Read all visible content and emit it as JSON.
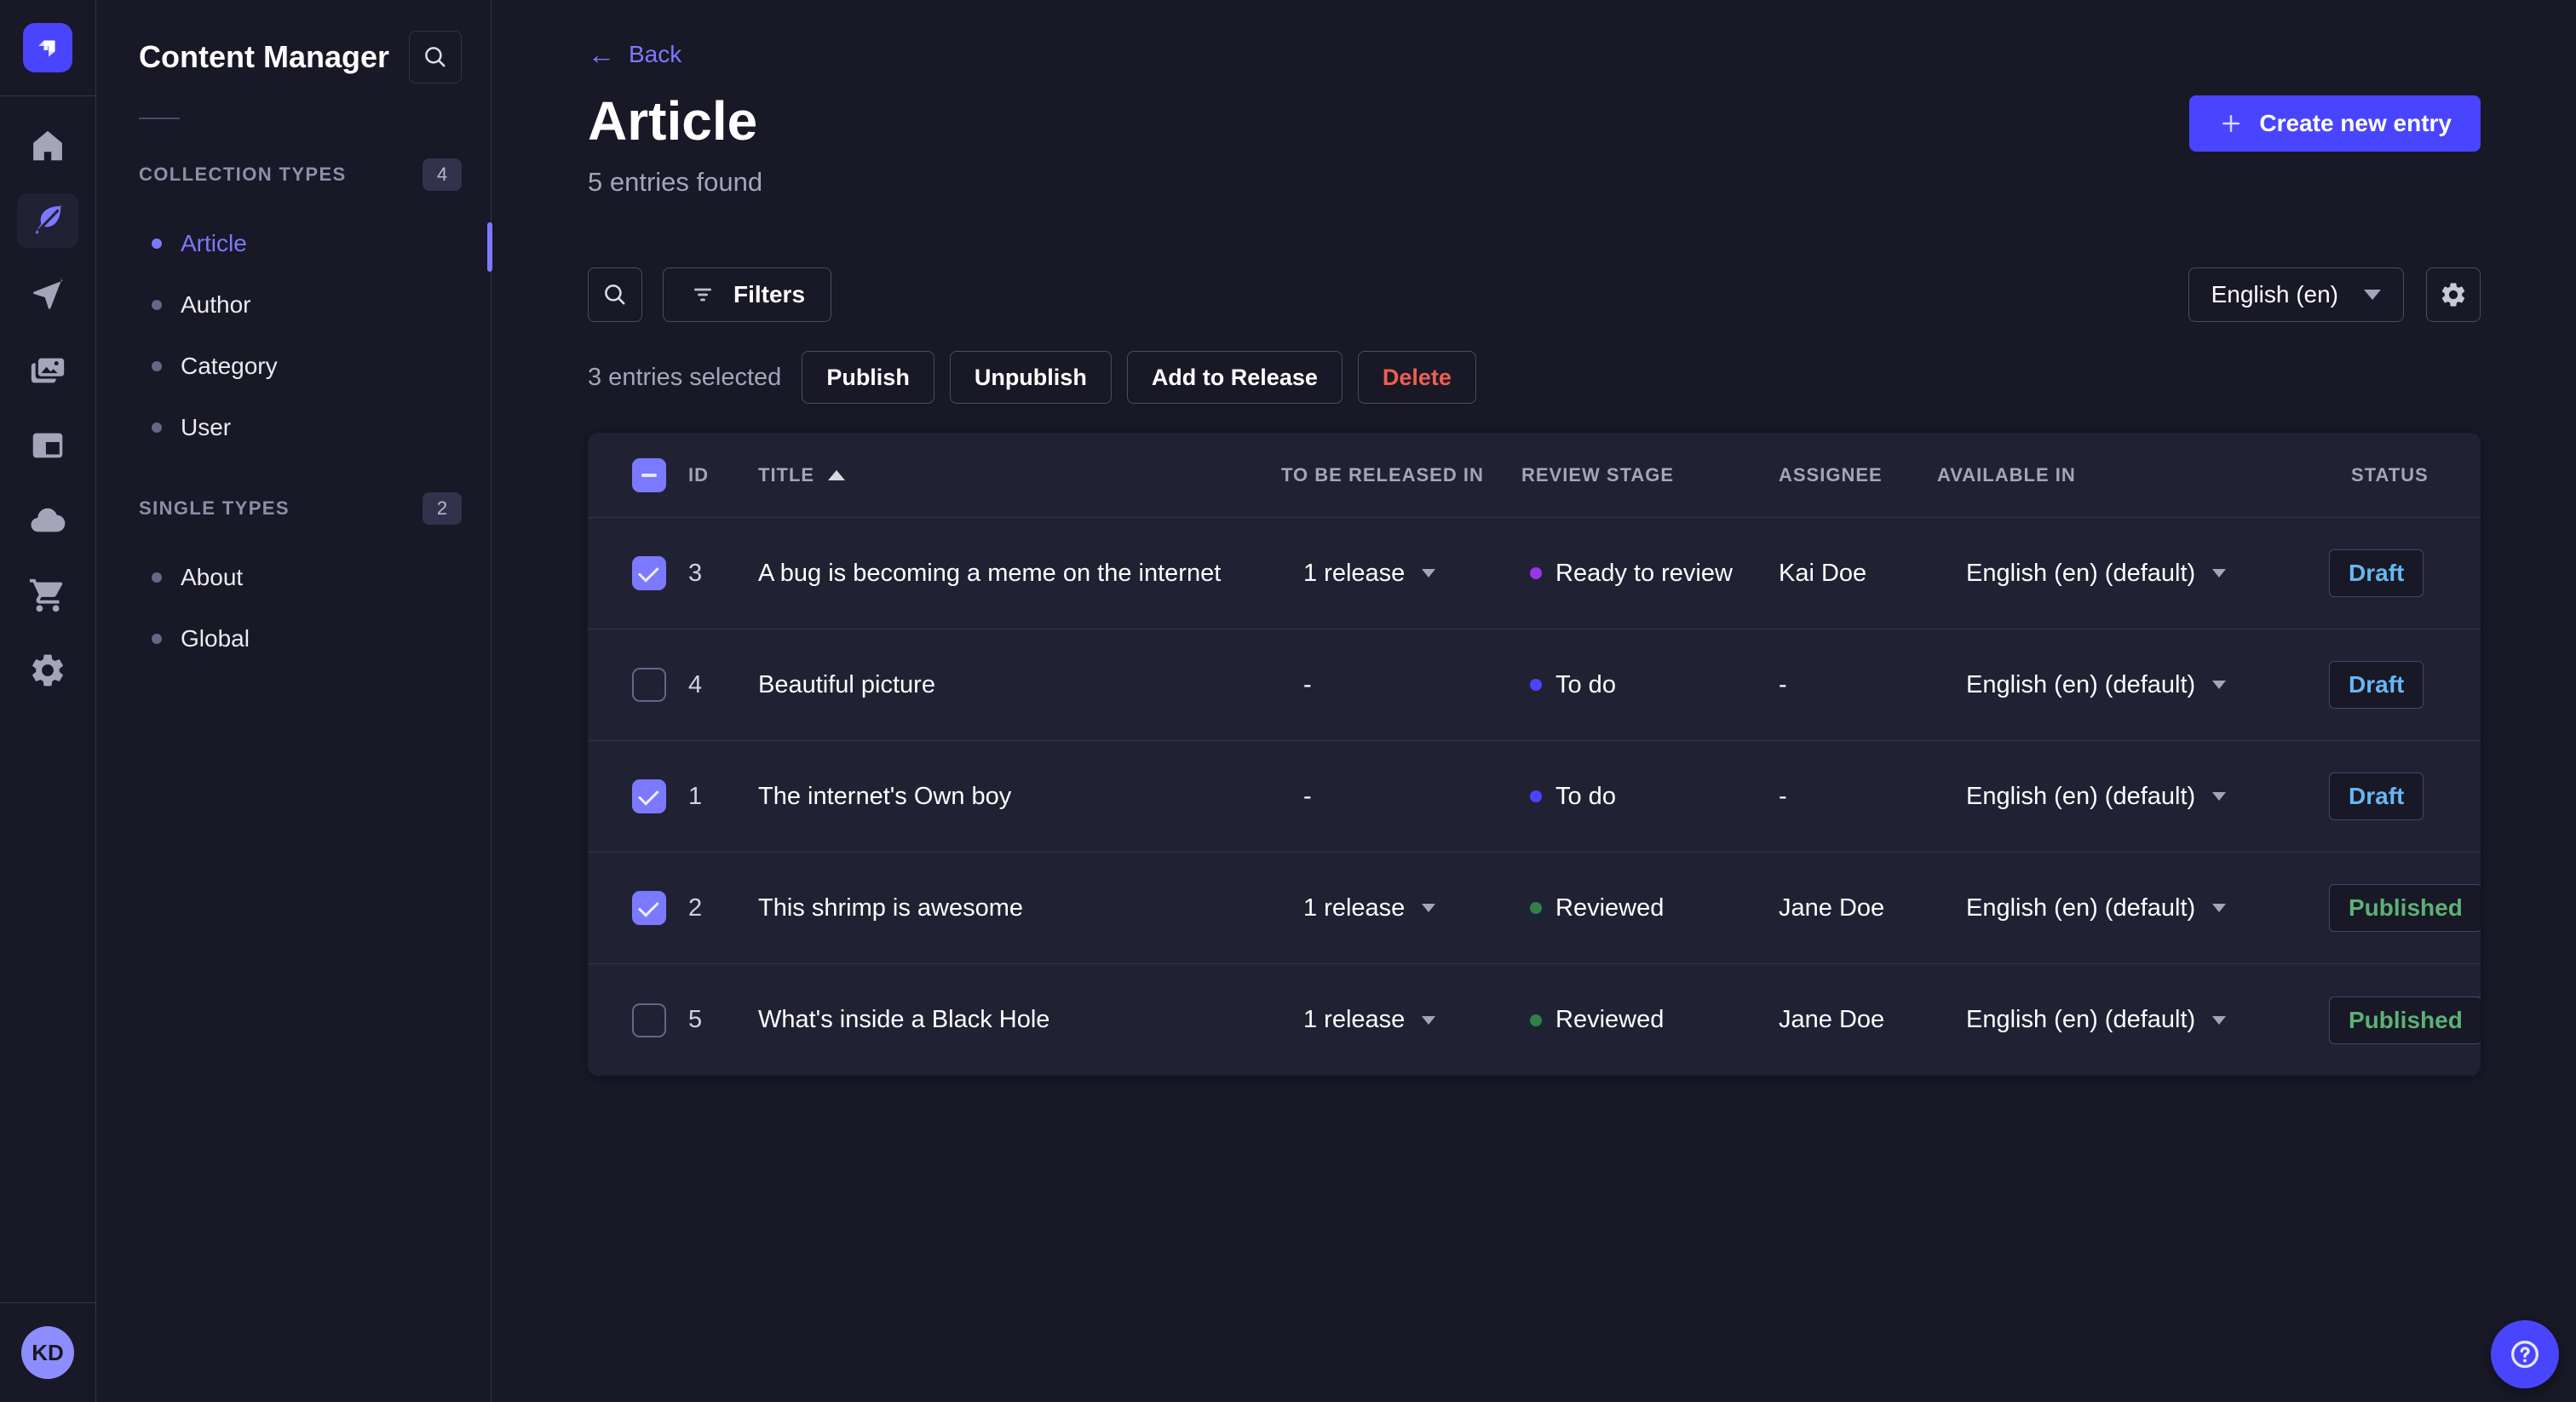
{
  "nav_rail": {
    "logo_icon": "strapi-logo",
    "icons": [
      "home",
      "content-manager",
      "releases",
      "media-library",
      "content-type-builder",
      "deploy",
      "marketplace",
      "settings"
    ],
    "active_icon": "content-manager",
    "avatar_initials": "KD"
  },
  "sidebar": {
    "title": "Content Manager",
    "search_icon": "search-icon",
    "sections": [
      {
        "label": "COLLECTION TYPES",
        "count": "4",
        "items": [
          {
            "label": "Article",
            "active": true
          },
          {
            "label": "Author"
          },
          {
            "label": "Category"
          },
          {
            "label": "User"
          }
        ]
      },
      {
        "label": "SINGLE TYPES",
        "count": "2",
        "items": [
          {
            "label": "About"
          },
          {
            "label": "Global"
          }
        ]
      }
    ]
  },
  "header": {
    "back_arrow": "←",
    "back_label": "Back",
    "title": "Article",
    "subtitle": "5 entries found",
    "create_label": "Create new entry"
  },
  "toolbar": {
    "filters_label": "Filters",
    "locale": "English (en)"
  },
  "selection": {
    "text": "3 entries selected",
    "actions": [
      "Publish",
      "Unpublish",
      "Add to Release",
      "Delete"
    ]
  },
  "table": {
    "columns": [
      "ID",
      "TITLE",
      "TO BE RELEASED IN",
      "REVIEW STAGE",
      "ASSIGNEE",
      "AVAILABLE IN",
      "STATUS"
    ],
    "sorted_column": "TITLE",
    "sort_direction": "asc",
    "rows": [
      {
        "checked": true,
        "id": "3",
        "title": "A bug is becoming a meme on the internet",
        "release": "1 release",
        "release_menu": true,
        "stage": "Ready to review",
        "stage_color": "#9736e8",
        "assignee": "Kai Doe",
        "available": "English (en) (default)",
        "status": "Draft",
        "status_variant": "draft"
      },
      {
        "checked": false,
        "id": "4",
        "title": "Beautiful picture",
        "release": "-",
        "release_menu": false,
        "stage": "To do",
        "stage_color": "#4945ff",
        "assignee": "-",
        "available": "English (en) (default)",
        "status": "Draft",
        "status_variant": "draft"
      },
      {
        "checked": true,
        "id": "1",
        "title": "The internet's Own boy",
        "release": "-",
        "release_menu": false,
        "stage": "To do",
        "stage_color": "#4945ff",
        "assignee": "-",
        "available": "English (en) (default)",
        "status": "Draft",
        "status_variant": "draft"
      },
      {
        "checked": true,
        "id": "2",
        "title": "This shrimp is awesome",
        "release": "1 release",
        "release_menu": true,
        "stage": "Reviewed",
        "stage_color": "#328048",
        "assignee": "Jane Doe",
        "available": "English (en) (default)",
        "status": "Published",
        "status_variant": "published"
      },
      {
        "checked": false,
        "id": "5",
        "title": "What's inside a Black Hole",
        "release": "1 release",
        "release_menu": true,
        "stage": "Reviewed",
        "stage_color": "#328048",
        "assignee": "Jane Doe",
        "available": "English (en) (default)",
        "status": "Published",
        "status_variant": "published"
      }
    ]
  },
  "help": {
    "icon": "question-mark-icon"
  },
  "colors": {
    "bg": "#181826",
    "surface": "#212134",
    "border": "#32324d",
    "borderLight": "#4a4a6a",
    "textPrimary": "#ffffff",
    "textSecondary": "#a5a5ba",
    "textMuted": "#8e8ea9",
    "accent": "#4945ff",
    "accentLight": "#7b79ff",
    "draft": "#66b7f1",
    "published": "#5cb176",
    "danger": "#ee5e52"
  }
}
